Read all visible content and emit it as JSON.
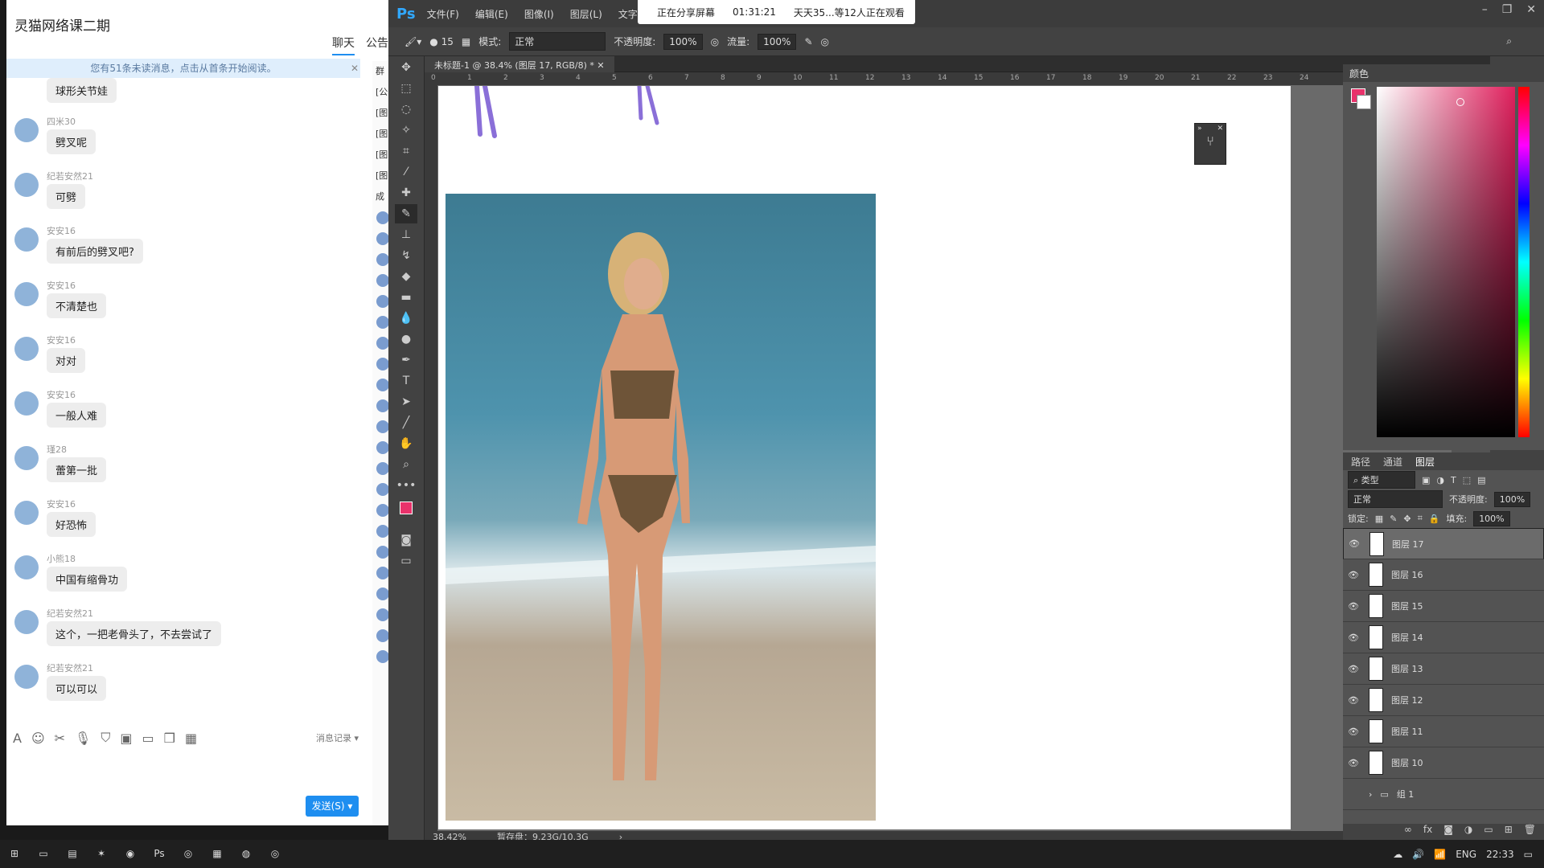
{
  "chat": {
    "title": "灵猫网络课二期",
    "tabs": [
      "聊天",
      "公告"
    ],
    "notice": "您有51条未读消息，点击从首条开始阅读。",
    "messages": [
      {
        "name": "",
        "text": "球形关节娃"
      },
      {
        "name": "四米30",
        "text": "劈叉呢"
      },
      {
        "name": "纪若安然21",
        "text": "可劈"
      },
      {
        "name": "安安16",
        "text": "有前后的劈叉吧?"
      },
      {
        "name": "安安16",
        "text": "不清楚也"
      },
      {
        "name": "安安16",
        "text": "对对"
      },
      {
        "name": "安安16",
        "text": "一般人难"
      },
      {
        "name": "瑾28",
        "text": "蕾第一批"
      },
      {
        "name": "安安16",
        "text": "好恐怖"
      },
      {
        "name": "小熊18",
        "text": "中国有缩骨功"
      },
      {
        "name": "纪若安然21",
        "text": "这个，一把老骨头了，不去尝试了"
      },
      {
        "name": "纪若安然21",
        "text": "可以可以"
      }
    ],
    "history_label": "消息记录",
    "send_label": "发送(S)",
    "members_header": "群",
    "members_items": [
      "[公",
      "[图",
      "[图",
      "[图",
      "[图"
    ],
    "members_label": "成"
  },
  "screen_share": {
    "status": "正在分享屏幕",
    "time": "01:31:21",
    "viewers": "天天35...等12人正在观看"
  },
  "ps": {
    "menu": [
      "文件(F)",
      "编辑(E)",
      "图像(I)",
      "图层(L)",
      "文字"
    ],
    "options": {
      "mode_label": "模式:",
      "mode_value": "正常",
      "opacity_label": "不透明度:",
      "opacity_value": "100%",
      "flow_label": "流量:",
      "flow_value": "100%",
      "brush_size": "15"
    },
    "doc_tab": "未标题-1 @ 38.4% (图层 17, RGB/8) *",
    "ruler_ticks": [
      "0",
      "1",
      "2",
      "3",
      "4",
      "5",
      "6",
      "7",
      "8",
      "9",
      "10",
      "11",
      "12",
      "13",
      "14",
      "15",
      "16",
      "17",
      "18",
      "19",
      "20",
      "21",
      "22",
      "23",
      "24"
    ],
    "status": {
      "zoom": "38.42%",
      "scratch": "暂存盘：9.23G/10.3G"
    },
    "color_panel_title": "颜色",
    "layer_tabs": [
      "路径",
      "通道",
      "图层"
    ],
    "layer_filter": "类型",
    "blend_mode": "正常",
    "opacity_label": "不透明度:",
    "opacity_value": "100%",
    "lock_label": "锁定:",
    "fill_label": "填充:",
    "fill_value": "100%",
    "layers": [
      "图层 17",
      "图层 16",
      "图层 15",
      "图层 14",
      "图层 13",
      "图层 12",
      "图层 11",
      "图层 10"
    ],
    "group": "组 1",
    "colors": {
      "foreground": "#e9326b",
      "background": "#ffffff",
      "cursor": "#f5e100"
    }
  },
  "taskbar": {
    "lang": "ENG",
    "time": "22:33"
  }
}
